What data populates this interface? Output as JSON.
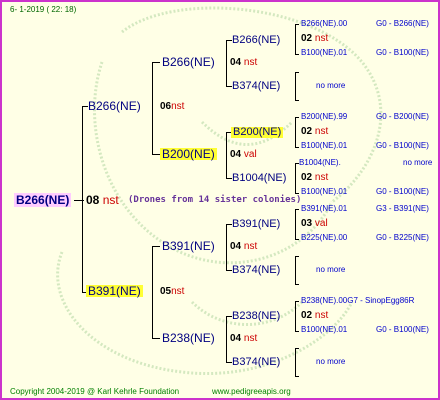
{
  "header": {
    "date": "6-  1-2019 (  22:  18)"
  },
  "root": {
    "label": "B266(NE)",
    "gen": "08",
    "suffix": "nst",
    "note": "(Drones from 14 sister colonies)"
  },
  "parents": {
    "sire": {
      "label": "B266(NE)",
      "gen": "06",
      "suffix": "nst"
    },
    "dam": {
      "label": "B391(NE)",
      "gen": "05",
      "suffix": "nst"
    }
  },
  "gp": {
    "b1": {
      "label": "B266(NE)",
      "gen": "04",
      "suffix": "nst"
    },
    "b2": {
      "label": "B200(NE)",
      "gen": "04",
      "suffix": "val"
    },
    "b3": {
      "label": "B391(NE)",
      "gen": "04",
      "suffix": "nst"
    },
    "b4": {
      "label": "B238(NE)",
      "gen": "04",
      "suffix": "nst"
    }
  },
  "ggp": {
    "l1": "B266(NE)",
    "l2": "B374(NE)",
    "l3": "B200(NE)",
    "l4": "B1004(NE)",
    "l5": "B391(NE)",
    "l6": "B374(NE)",
    "l7": "B238(NE)",
    "l8": "B374(NE)"
  },
  "ggg": {
    "g1": {
      "top": "B266(NE).00",
      "gen": "02",
      "suffix": "nst",
      "bot": "B100(NE).01",
      "topr": "G0 - B266(NE)",
      "botr": "G0 - B100(NE)"
    },
    "g3": {
      "top": "B200(NE).99",
      "gen": "02",
      "suffix": "nst",
      "bot": "B100(NE).01",
      "topr": "G0 - B200(NE)",
      "botr": "G0 - B100(NE)"
    },
    "g4": {
      "top": "B1004(NE).",
      "gen": "02",
      "suffix": "nst",
      "bot": "B100(NE).01",
      "topr": "no more",
      "botr": "G0 - B100(NE)"
    },
    "g5": {
      "top": "B391(NE).01",
      "gen": "03",
      "suffix": "val",
      "bot": "B225(NE).00",
      "topr": "G3 - B391(NE)",
      "botr": "G0 - B225(NE)"
    },
    "g7": {
      "top": "B238(NE).00G7 - SinopEgg86R",
      "gen": "02",
      "suffix": "nst",
      "bot": "B100(NE).01",
      "botr": "G0 - B100(NE)"
    }
  },
  "nomore": {
    "n2": "no more",
    "n6": "no more",
    "n8": "no more"
  },
  "footer": {
    "copyright": "Copyright 2004-2019 @ Karl Kehrle Foundation",
    "url": "www.pedigreeapis.org"
  }
}
